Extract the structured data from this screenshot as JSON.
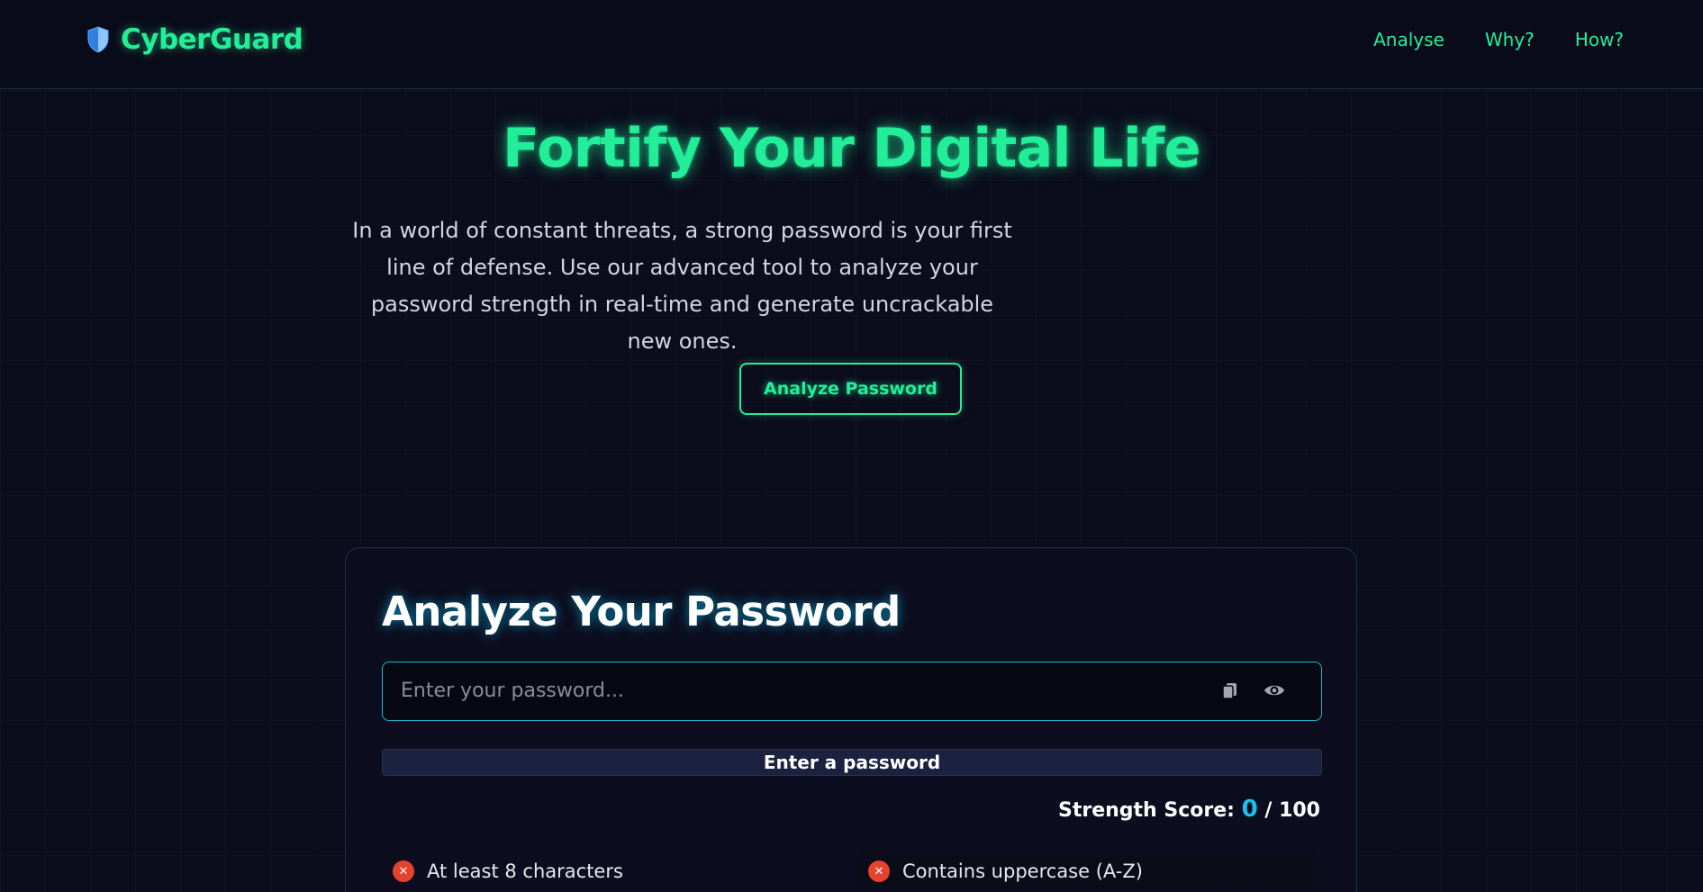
{
  "header": {
    "brand": "CyberGuard",
    "brand_icon": "shield-icon",
    "nav": [
      "Analyse",
      "Why?",
      "How?"
    ]
  },
  "hero": {
    "title": "Fortify Your Digital Life",
    "description": "In a world of constant threats, a strong password is your first line of defense. Use our advanced tool to analyze your password strength in real-time and generate uncrackable new ones.",
    "button_label": "Analyze Password"
  },
  "analyzer": {
    "title": "Analyze Your Password",
    "input_placeholder": "Enter your password...",
    "input_value": "",
    "copy_icon": "copy-icon",
    "visibility_icon": "eye-icon",
    "strength_label": "Enter a password",
    "strength_fill": 0,
    "score_label": "Strength Score:",
    "score_value": "0",
    "score_max": "/ 100",
    "criteria": [
      {
        "label": "At least 8 characters",
        "met": false,
        "icon": "x-circle-icon"
      },
      {
        "label": "Contains uppercase (A-Z)",
        "met": false,
        "icon": "x-circle-icon"
      }
    ]
  },
  "colors": {
    "accent_green": "#22ee99",
    "accent_cyan": "#19c2ee",
    "fail_red": "#e5432e",
    "background": "#0b0c1c"
  }
}
